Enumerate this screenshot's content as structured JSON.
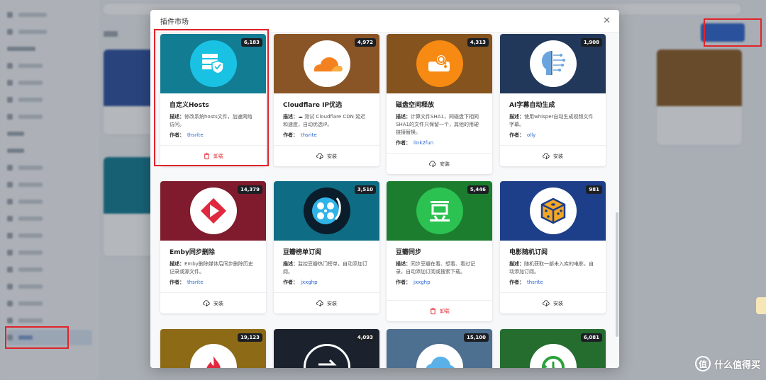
{
  "modal": {
    "title": "插件市场",
    "close_icon": "close-icon"
  },
  "labels": {
    "desc_prefix": "描述：",
    "author_prefix": "作者："
  },
  "plugins": [
    {
      "title": "自定义Hosts",
      "count": "6,183",
      "desc": "修改系统hosts文件，加速网络访问。",
      "author": "thsrite",
      "action": "卸载",
      "action_type": "uninstall",
      "bg": "#127c93",
      "icon": "hosts-shield-icon"
    },
    {
      "title": "Cloudflare IP优选",
      "count": "4,972",
      "desc": "☁ 测试 Cloudflare CDN 延迟和速度，自动优选IP。",
      "author": "thsrite",
      "action": "安装",
      "action_type": "install",
      "bg": "#8a5526",
      "icon": "cloudflare-icon"
    },
    {
      "title": "磁盘空间释放",
      "count": "4,313",
      "desc": "计算文件SHA1，同磁盘下相同SHA1的文件只保留一个，其他的用硬链接替换。",
      "author": "link2fun",
      "action": "安装",
      "action_type": "install",
      "bg": "#85531d",
      "icon": "disk-search-icon"
    },
    {
      "title": "AI字幕自动生成",
      "count": "1,908",
      "desc": "使用whisper自动生成视频文件字幕。",
      "author": "olly",
      "action": "安装",
      "action_type": "install",
      "bg": "#22385a",
      "icon": "ai-brain-icon"
    },
    {
      "title": "Emby同步删除",
      "count": "14,379",
      "desc": "Emby删除媒体后同步删除历史记录或源文件。",
      "author": "thsrite",
      "action": "安装",
      "action_type": "install",
      "bg": "#7f1b2c",
      "icon": "emby-play-icon"
    },
    {
      "title": "豆瓣榜单订阅",
      "count": "3,510",
      "desc": "监控豆瓣热门榜单，自动添加订阅。",
      "author": "jxxghp",
      "action": "安装",
      "action_type": "install",
      "bg": "#0e6d84",
      "icon": "film-reel-icon"
    },
    {
      "title": "豆瓣同步",
      "count": "5,446",
      "desc": "同步豆瓣在看、想看、看过记录，自动添加订阅或搜索下载。",
      "author": "jxxghp",
      "action": "卸载",
      "action_type": "uninstall",
      "bg": "#1d7d2e",
      "icon": "douban-icon"
    },
    {
      "title": "电影随机订阅",
      "count": "981",
      "desc": "随机获取一部未入库的电影，自动添加订阅。",
      "author": "thsrite",
      "action": "安装",
      "action_type": "install",
      "bg": "#1d3f8a",
      "icon": "dice-icon"
    },
    {
      "title": "",
      "count": "19,123",
      "desc": "",
      "author": "",
      "action": "",
      "action_type": "",
      "bg": "#8d6a16",
      "icon": "fire-icon"
    },
    {
      "title": "",
      "count": "4,093",
      "desc": "",
      "author": "",
      "action": "",
      "action_type": "",
      "bg": "#1b222e",
      "icon": "swap-arrows-icon"
    },
    {
      "title": "",
      "count": "15,100",
      "desc": "",
      "author": "",
      "action": "",
      "action_type": "",
      "bg": "#4d6f90",
      "icon": "cloud-icon"
    },
    {
      "title": "",
      "count": "6,081",
      "desc": "",
      "author": "",
      "action": "",
      "action_type": "",
      "bg": "#256c2f",
      "icon": "refresh-clock-icon"
    }
  ],
  "watermark": {
    "text": "什么值得买",
    "icon": "值"
  }
}
